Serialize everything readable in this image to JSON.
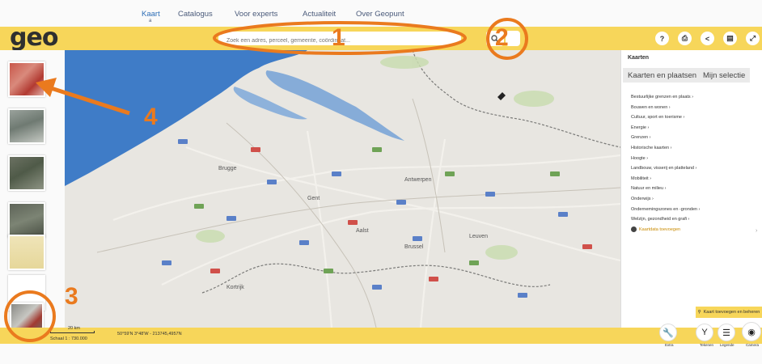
{
  "nav": {
    "items": [
      "Kaart",
      "Catalogus",
      "Voor experts",
      "Actualiteit",
      "Over Geopunt"
    ],
    "sub": "a"
  },
  "header": {
    "logo": "geo",
    "search_placeholder": "Zoek een adres, perceel, gemeente, coördinaat...",
    "icons": [
      "help-icon",
      "print-icon",
      "share-icon",
      "bookmark-icon",
      "fullscreen-icon"
    ],
    "icon_glyphs": [
      "?",
      "⎙",
      "<",
      "▤",
      "⤢"
    ]
  },
  "panel": {
    "title": "Kaarten",
    "tabs": [
      "Kaarten en plaatsen",
      "Mijn selectie"
    ],
    "layers": [
      "Bestuurlijke grenzen en plaats ›",
      "Bouwen en wonen ›",
      "Cultuur, sport en toerisme ›",
      "Energie ›",
      "Grenzen ›",
      "Historische kaarten ›",
      "Hoogte ›",
      "Landbouw, visserij en platteland ›",
      "Mobiliteit ›",
      "Natuur en milieu ›",
      "Onderwijs ›",
      "Ondernemingszones en -gronden ›",
      "Welzijn, gezondheid en grafi ›"
    ],
    "more_link": "Kaartdata toevoegen",
    "select_button": "Kaart toevoegen en beheren"
  },
  "footer": {
    "scale_bar": "20 km",
    "scale_text": "Schaal 1 : 730.000",
    "coords": "50°59'N 3°48'W - 213745,4957N"
  },
  "tools": [
    "Extra",
    "Tekenen",
    "Legende",
    "Camera"
  ],
  "map": {
    "city_labels": [
      "Brugge",
      "Antwerpen",
      "Gent",
      "Brussel",
      "Aalst",
      "Kortrijk",
      "Leuven"
    ]
  },
  "annotations": [
    "1",
    "2",
    "3",
    "4"
  ],
  "colors": {
    "accent": "#f7d65a",
    "annotation": "#ea7a1e",
    "sea": "#3a78c6",
    "land": "#e8e6e1"
  }
}
